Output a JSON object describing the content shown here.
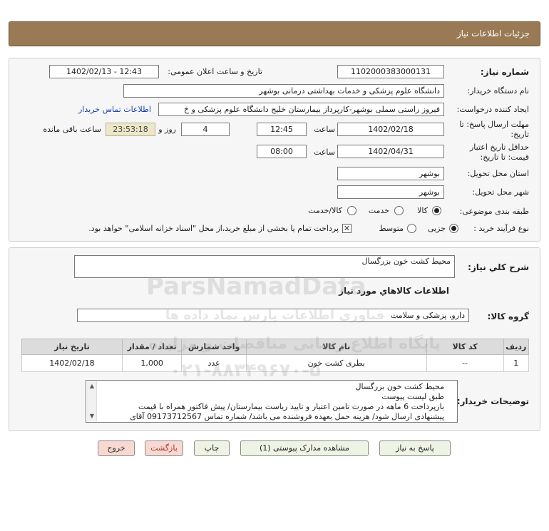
{
  "header": {
    "title": "جزئیات اطلاعات نیاز"
  },
  "form": {
    "need_number_label": "شماره نیاز:",
    "need_number": "1102000383000131",
    "announce_label": "تاریخ و ساعت اعلان عمومی:",
    "announce_value": "1402/02/13 - 12:43",
    "buyer_org_label": "نام دستگاه خریدار:",
    "buyer_org": "دانشگاه علوم پزشکی و خدمات بهداشتی درمانی بوشهر",
    "creator_label": "ایجاد کننده درخواست:",
    "creator": "فیروز راستی سملی بوشهر-کارپرداز بیمارستان خلیج دانشگاه علوم پزشکی و خ",
    "contact_link": "اطلاعات تماس خریدار",
    "deadline_label_1": "مهلت ارسال پاسخ: تا",
    "deadline_label_2": "تاریخ:",
    "deadline_date": "1402/02/18",
    "time_label": "ساعت",
    "deadline_time": "12:45",
    "days_value": "4",
    "days_label": "روز و",
    "remaining_time": "23:53:18",
    "remaining_label": "ساعت باقی مانده",
    "validity_label_1": "حداقل تاریخ اعتبار",
    "validity_label_2": "قیمت: تا تاریخ:",
    "validity_date": "1402/04/31",
    "validity_time": "08:00",
    "province_label": "استان محل تحویل:",
    "province": "بوشهر",
    "city_label": "شهر محل تحویل:",
    "city": "بوشهر",
    "category_label": "طبقه بندی موضوعی:",
    "category_options": [
      "کالا",
      "خدمت",
      "کالا/خدمت"
    ],
    "category_selected": "کالا",
    "purchase_type_label": "نوع فرآیند خرید :",
    "purchase_options": [
      "جزیی",
      "متوسط"
    ],
    "purchase_selected": "جزیی",
    "payment_note": "پرداخت تمام یا بخشی از مبلغ خرید،از محل \"اسناد خزانه اسلامی\" خواهد بود."
  },
  "summary": {
    "label": "شرح کلي نياز:",
    "value": "محیط کشت خون بزرگسال"
  },
  "goods_info": {
    "title": "اطلاعات کالاهاي مورد نياز",
    "group_label": "گروه کالا:",
    "group_value": "دارو، پزشکی و سلامت"
  },
  "table": {
    "headers": [
      "ردیف",
      "کد کالا",
      "نام کالا",
      "واحد شمارش",
      "تعداد / مقدار",
      "تاریخ نیاز"
    ],
    "rows": [
      [
        "1",
        "--",
        "بطری کشت خون",
        "عدد",
        "1,000",
        "1402/02/18"
      ]
    ]
  },
  "buyer_notes": {
    "label": "توضیحات خریدار:",
    "lines": [
      "محیط کشت خون بزرگسال",
      "طبق لیست پیوست",
      "بازپرداخت 6 ماهه در صورت تامین اعتبار و تایید ریاست بیمارستان/ پیش فاکتور همراه با قیمت",
      "پیشنهادی ارسال شود/ هزینه حمل بعهده فروشنده می باشد/ شماره تماس 09173712567 آقای"
    ]
  },
  "buttons": {
    "reply": "پاسخ به نیاز",
    "attachments": "مشاهده مدارک پیوستی (1)",
    "print": "چاپ",
    "back": "بازگشت",
    "exit": "خروج"
  },
  "watermark": {
    "brand": "ParsNamadData",
    "persian_1": "فناوری اطلاعات پارس نماد داده ها",
    "persian_2": "پایگاه اطلاع رسانی مناقصات و مزایده",
    "phone": "۰۲۱-۸۸۳۴۹۶۷۰-۵"
  }
}
